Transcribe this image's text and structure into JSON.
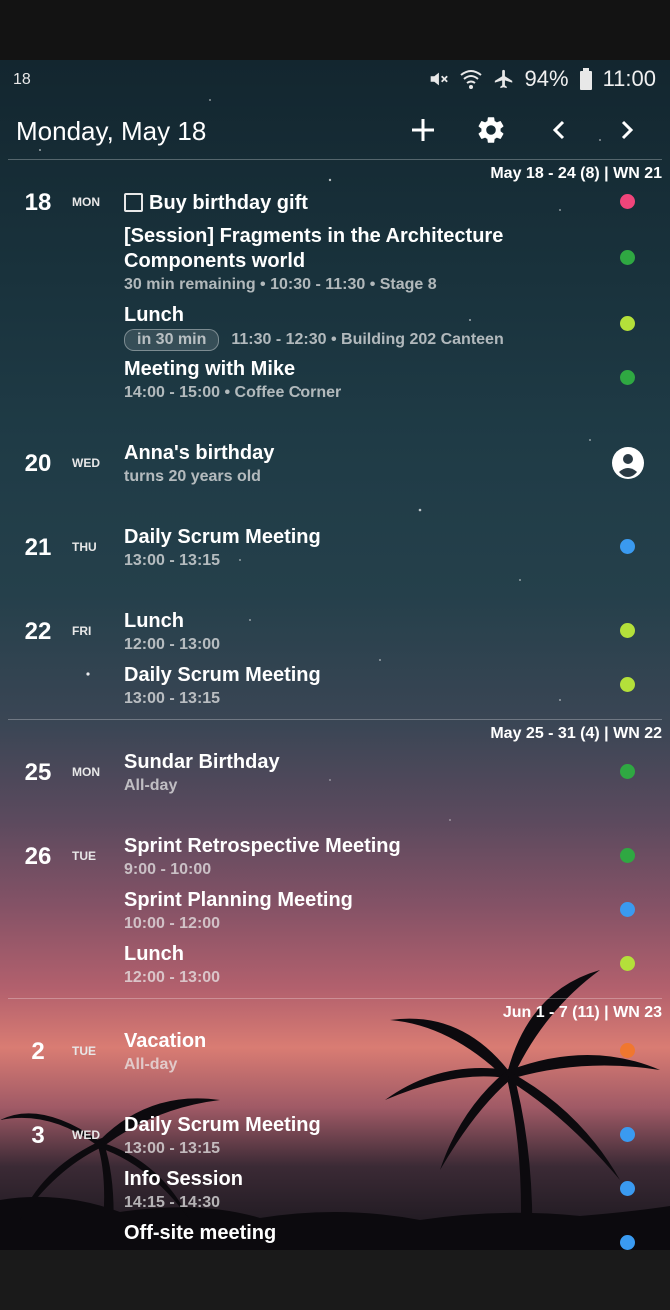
{
  "status_bar": {
    "notification_count": "18",
    "battery": "94%",
    "time": "11:00",
    "icons": [
      "mute-icon",
      "wifi-icon",
      "airplane-icon",
      "battery-icon"
    ]
  },
  "header": {
    "title": "Monday, May 18",
    "add_icon": "plus-icon",
    "settings_icon": "gear-icon",
    "prev_icon": "chevron-left-icon",
    "next_icon": "chevron-right-icon"
  },
  "colors": {
    "pink": "#f0457a",
    "green": "#2fa842",
    "lime": "#b4e03a",
    "blue": "#3a9af0",
    "orange": "#f0772f"
  },
  "weeks": [
    {
      "label": "May 18 - 24 (8) | WN 21"
    },
    {
      "label": "May 25 - 31 (4) | WN 22"
    },
    {
      "label": "Jun 1 - 7 (11) | WN 23"
    }
  ],
  "days": [
    {
      "day": "18",
      "dow": "MON",
      "events": [
        {
          "title": "Buy birthday gift",
          "checkbox": true,
          "color": "pink"
        },
        {
          "title_lines": [
            "[Session] Fragments in the Architecture",
            "Components world"
          ],
          "subtitle": "30 min remaining  •  10:30 - 11:30  •  Stage 8",
          "color": "green"
        },
        {
          "title": "Lunch",
          "chip": "in 30 min",
          "subtitle": "11:30 - 12:30  •  Building 202 Canteen",
          "color": "lime"
        },
        {
          "title": "Meeting with Mike",
          "subtitle": "14:00 - 15:00  •  Coffee Corner",
          "color": "green"
        }
      ]
    },
    {
      "day": "20",
      "dow": "WED",
      "events": [
        {
          "title": "Anna's birthday",
          "subtitle": "turns 20 years old",
          "icon": "person-icon"
        }
      ]
    },
    {
      "day": "21",
      "dow": "THU",
      "events": [
        {
          "title": "Daily Scrum Meeting",
          "subtitle": "13:00 - 13:15",
          "color": "blue"
        }
      ]
    },
    {
      "day": "22",
      "dow": "FRI",
      "events": [
        {
          "title": "Lunch",
          "subtitle": "12:00 - 13:00",
          "color": "lime"
        },
        {
          "title": "Daily Scrum Meeting",
          "subtitle": "13:00 - 13:15",
          "color": "lime"
        }
      ]
    },
    {
      "day": "25",
      "dow": "MON",
      "events": [
        {
          "title": "Sundar Birthday",
          "subtitle": "All-day",
          "color": "green"
        }
      ]
    },
    {
      "day": "26",
      "dow": "TUE",
      "events": [
        {
          "title": "Sprint Retrospective Meeting",
          "subtitle": "9:00 - 10:00",
          "color": "green"
        },
        {
          "title": "Sprint Planning Meeting",
          "subtitle": "10:00 - 12:00",
          "color": "blue"
        },
        {
          "title": "Lunch",
          "subtitle": "12:00 - 13:00",
          "color": "lime"
        }
      ]
    },
    {
      "day": "2",
      "dow": "TUE",
      "events": [
        {
          "title": "Vacation",
          "subtitle": "All-day",
          "color": "orange"
        }
      ]
    },
    {
      "day": "3",
      "dow": "WED",
      "events": [
        {
          "title": "Daily Scrum Meeting",
          "subtitle": "13:00 - 13:15",
          "color": "blue"
        },
        {
          "title": "Info Session",
          "subtitle": "14:15 - 14:30",
          "color": "blue"
        },
        {
          "title": "Off-site meeting",
          "color": "blue"
        }
      ]
    }
  ]
}
